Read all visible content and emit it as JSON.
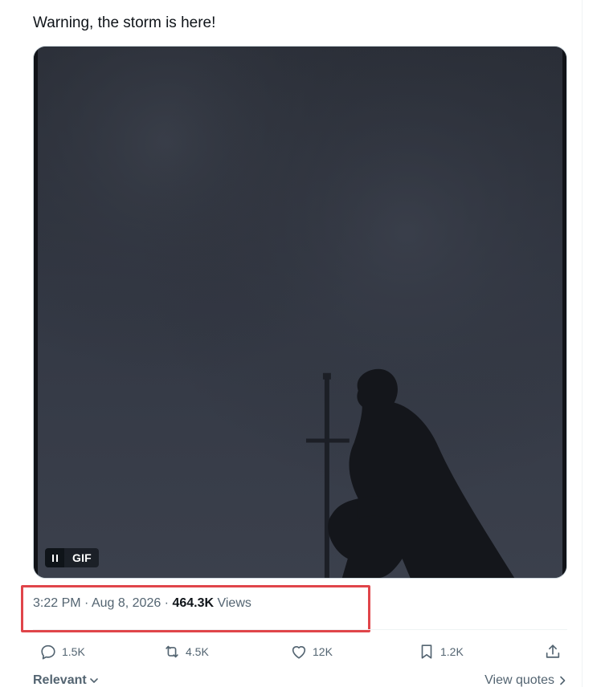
{
  "tweet": {
    "text": "Warning, the storm is here!"
  },
  "media": {
    "badge_label": "GIF",
    "pause_icon": "pause-icon"
  },
  "meta": {
    "time": "3:22 PM",
    "separator_1": " · ",
    "date": "Aug 8, 2026",
    "separator_2": " · ",
    "views_count": "464.3K",
    "views_label": " Views",
    "highlight_color": "#e0454a"
  },
  "actions": {
    "reply": {
      "icon": "reply-icon",
      "count": "1.5K"
    },
    "repost": {
      "icon": "repost-icon",
      "count": "4.5K"
    },
    "like": {
      "icon": "heart-icon",
      "count": "12K"
    },
    "bookmark": {
      "icon": "bookmark-icon",
      "count": "1.2K"
    },
    "share": {
      "icon": "share-icon"
    }
  },
  "footer": {
    "sort_label": "Relevant",
    "view_quotes_label": "View quotes"
  },
  "colors": {
    "text_primary": "#0f1419",
    "text_secondary": "#536471",
    "divider": "#eff3f4"
  }
}
